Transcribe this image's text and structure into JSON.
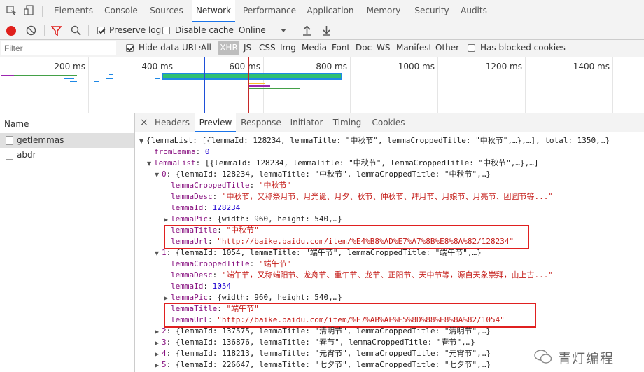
{
  "devtools": {
    "tabs": [
      "Elements",
      "Console",
      "Sources",
      "Network",
      "Performance",
      "Application",
      "Memory",
      "Security",
      "Audits"
    ],
    "active_tab": "Network"
  },
  "toolbar": {
    "preserve_log": "Preserve log",
    "disable_cache": "Disable cache",
    "throttling": "Online"
  },
  "filterbar": {
    "filter_placeholder": "Filter",
    "hide_data_urls": "Hide data URLs",
    "types": [
      "All",
      "XHR",
      "JS",
      "CSS",
      "Img",
      "Media",
      "Font",
      "Doc",
      "WS",
      "Manifest",
      "Other"
    ],
    "active_type": "XHR",
    "has_blocked_cookies": "Has blocked cookies"
  },
  "timeline": {
    "ticks": [
      "200 ms",
      "400 ms",
      "600 ms",
      "800 ms",
      "1000 ms",
      "1200 ms",
      "1400 ms"
    ]
  },
  "requests": {
    "header": "Name",
    "items": [
      "getlemmas",
      "abdr"
    ]
  },
  "detail": {
    "close": "×",
    "tabs": [
      "Headers",
      "Preview",
      "Response",
      "Initiator",
      "Timing",
      "Cookies"
    ],
    "active_tab": "Preview"
  },
  "preview": {
    "l1": "{lemmaList: [{lemmaId: 128234, lemmaTitle: \"中秋节\", lemmaCroppedTitle: \"中秋节\",…},…], total: 1350,…}",
    "from_key": "fromLemma",
    "from_val": "0",
    "list_key": "lemmaList",
    "list_val": "[{lemmaId: 128234, lemmaTitle: \"中秋节\", lemmaCroppedTitle: \"中秋节\",…},…]",
    "i0_key": "0",
    "i0_val": "{lemmaId: 128234, lemmaTitle: \"中秋节\", lemmaCroppedTitle: \"中秋节\",…}",
    "i0_cropped": "\"中秋节\"",
    "i0_desc": "\"中秋节，又称祭月节、月光诞、月夕、秋节、仲秋节、拜月节、月娘节、月亮节、团圆节等...\"",
    "i0_id": "128234",
    "i0_pic": "{width: 960, height: 540,…}",
    "i0_title": "\"中秋节\"",
    "i0_url": "\"http://baike.baidu.com/item/%E4%B8%AD%E7%A7%8B%E8%8A%82/128234\"",
    "i1_key": "1",
    "i1_val": "{lemmaId: 1054, lemmaTitle: \"端午节\", lemmaCroppedTitle: \"端午节\",…}",
    "i1_cropped": "\"端午节\"",
    "i1_desc": "\"端午节，又称端阳节、龙舟节、重午节、龙节、正阳节、天中节等，源自天象崇拜，由上古...\"",
    "i1_id": "1054",
    "i1_pic": "{width: 960, height: 540,…}",
    "i1_title": "\"端午节\"",
    "i1_url": "\"http://baike.baidu.com/item/%E7%AB%AF%E5%8D%88%E8%8A%82/1054\"",
    "i2": "{lemmaId: 137575, lemmaTitle: \"清明节\", lemmaCroppedTitle: \"清明节\",…}",
    "i3": "{lemmaId: 136876, lemmaTitle: \"春节\", lemmaCroppedTitle: \"春节\",…}",
    "i4": "{lemmaId: 118213, lemmaTitle: \"元宵节\", lemmaCroppedTitle: \"元宵节\",…}",
    "i5": "{lemmaId: 226647, lemmaTitle: \"七夕节\", lemmaCroppedTitle: \"七夕节\",…}",
    "key_cropped": "lemmaCroppedTitle",
    "key_desc": "lemmaDesc",
    "key_id": "lemmaId",
    "key_pic": "lemmaPic",
    "key_title": "lemmaTitle",
    "key_url": "lemmaUrl"
  },
  "watermark": "青灯编程"
}
